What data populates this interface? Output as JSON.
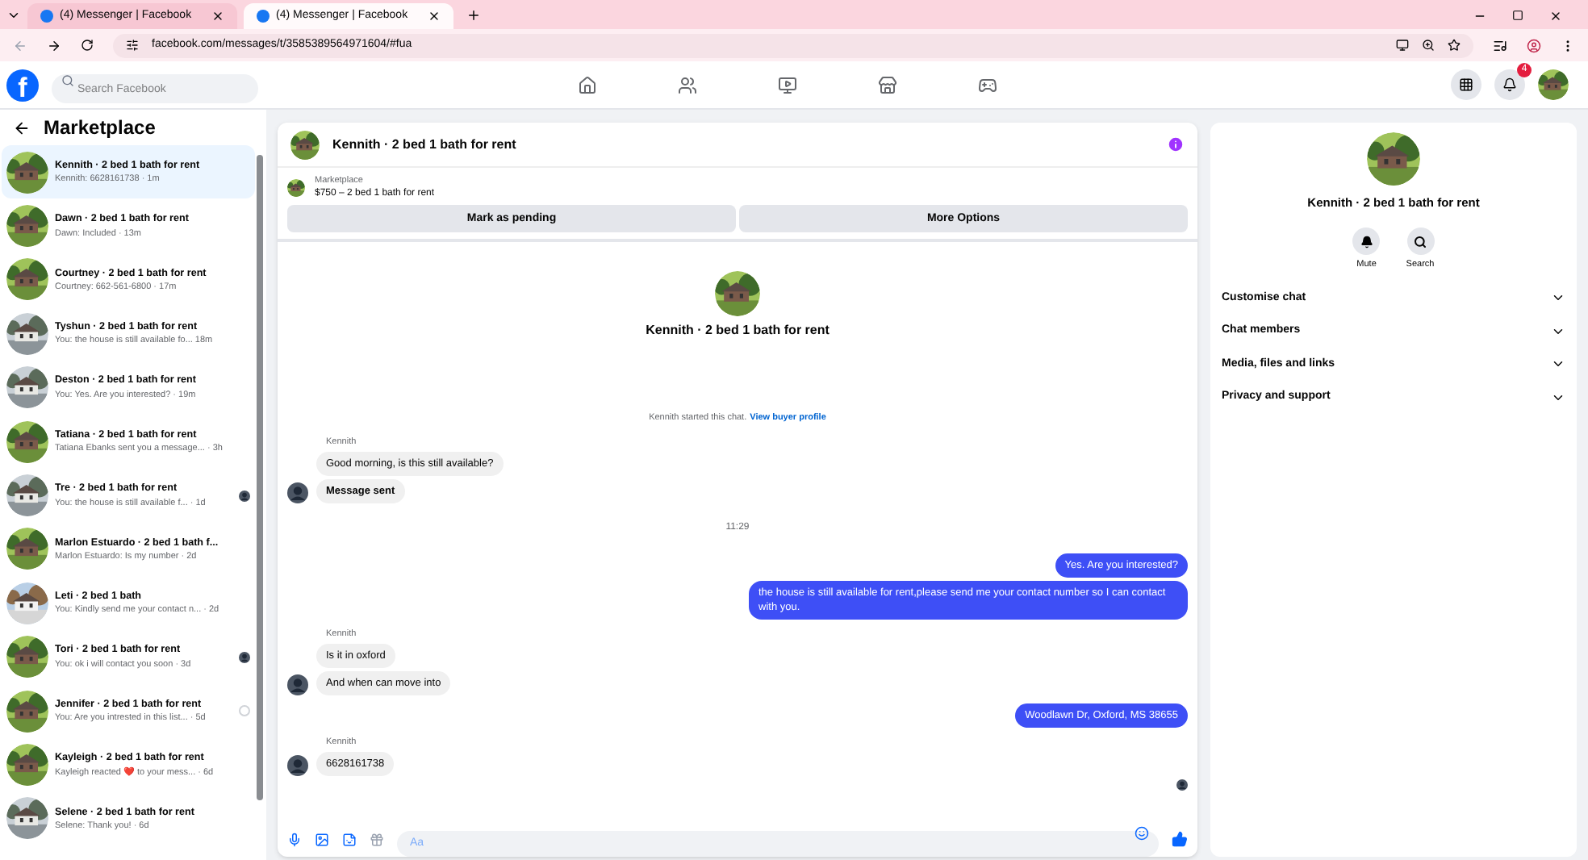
{
  "browser": {
    "tabs": [
      {
        "title": "(4) Messenger | Facebook",
        "selected": false
      },
      {
        "title": "(4) Messenger | Facebook",
        "selected": true
      }
    ],
    "url": "facebook.com/messages/t/3585389564971604/#fua"
  },
  "header": {
    "logo": "f",
    "search_placeholder": "Search Facebook",
    "notification_count": "4"
  },
  "sidebar": {
    "title": "Marketplace",
    "conversations": [
      {
        "name": "Kennith · 2 bed 1 bath for rent",
        "preview": "Kennith: 6628161738 · 1m",
        "selected": true
      },
      {
        "name": "Dawn · 2 bed 1 bath for rent",
        "preview": "Dawn: Included · 13m",
        "selected": false
      },
      {
        "name": "Courtney · 2 bed 1 bath for rent",
        "preview": "Courtney: 662-561-6800 · 17m",
        "selected": false
      },
      {
        "name": "Tyshun · 2 bed 1 bath for rent",
        "preview": "You: the house is still available fo...  18m",
        "selected": false
      },
      {
        "name": "Deston · 2 bed 1 bath for rent",
        "preview": "You: Yes. Are you interested? · 19m",
        "selected": false
      },
      {
        "name": "Tatiana · 2 bed 1 bath for rent",
        "preview": "Tatiana Ebanks sent you a message... · 3h",
        "selected": false
      },
      {
        "name": "Tre · 2 bed 1 bath for rent",
        "preview": "You: the house is still available f... · 1d",
        "selected": false,
        "kind": "seen"
      },
      {
        "name": "Marlon Estuardo · 2 bed 1 bath f...",
        "preview": "Marlon Estuardo: Is my number · 2d",
        "selected": false
      },
      {
        "name": "Leti · 2 bed 1 bath",
        "preview": "You: Kindly send me your contact n... · 2d",
        "selected": false
      },
      {
        "name": "Tori · 2 bed 1 bath for rent",
        "preview": "You: ok i will contact you soon · 3d",
        "selected": false,
        "kind": "seen"
      },
      {
        "name": "Jennifer · 2 bed 1 bath for rent",
        "preview": "You: Are you intrested in this list... · 5d",
        "selected": false,
        "kind": "sent"
      },
      {
        "name": "Kayleigh · 2 bed 1 bath for rent",
        "preview": "Kayleigh reacted ❤️ to your mess... · 6d",
        "selected": false
      },
      {
        "name": "Selene · 2 bed 1 bath for rent",
        "preview": "Selene: Thank you! · 6d",
        "selected": false
      }
    ]
  },
  "chat": {
    "title": "Kennith · 2 bed 1 bath for rent",
    "listing": {
      "label": "Marketplace",
      "price_title": "$750 – 2 bed 1 bath for rent"
    },
    "actions": [
      "Mark as pending",
      "More Options"
    ],
    "intro_name": "Kennith · 2 bed 1 bath for rent",
    "intro_note": "Kennith started this chat.",
    "intro_link": "View buyer profile",
    "timeline": [
      {
        "kind": "incoming",
        "sender": "Kennith",
        "messages": [
          {
            "text": "Good morning, is this still available?",
            "bold": false
          },
          {
            "text": "Message sent",
            "bold": true
          }
        ]
      },
      {
        "kind": "time",
        "text": "11:29"
      },
      {
        "kind": "outgoing",
        "messages": [
          {
            "text": "Yes. Are you interested?",
            "bold": false
          },
          {
            "text": "the house is still available for rent,please send me your contact number so I can contact with you.",
            "bold": false
          }
        ]
      },
      {
        "kind": "incoming",
        "sender": "Kennith",
        "messages": [
          {
            "text": "Is it in oxford",
            "bold": false
          },
          {
            "text": "And when can move into",
            "bold": false
          }
        ]
      },
      {
        "kind": "outgoing",
        "messages": [
          {
            "text": "Woodlawn Dr, Oxford, MS 38655",
            "bold": false
          }
        ]
      },
      {
        "kind": "incoming",
        "sender": "Kennith",
        "messages": [
          {
            "text": "6628161738",
            "bold": false
          }
        ]
      }
    ],
    "composer_placeholder": "Aa"
  },
  "details": {
    "name": "Kennith · 2 bed 1 bath for rent",
    "buttons": [
      {
        "label": "Mute"
      },
      {
        "label": "Search"
      }
    ],
    "sections": [
      "Customise chat",
      "Chat members",
      "Media, files and links",
      "Privacy and support"
    ]
  }
}
